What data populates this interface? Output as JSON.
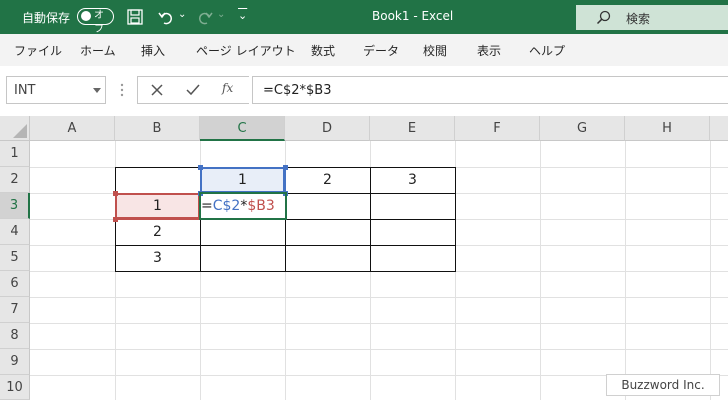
{
  "titlebar": {
    "autosave_label": "自動保存",
    "autosave_state": "オフ",
    "undo_caret": "⌄",
    "redo_caret": "⌄",
    "customize": "⌄",
    "doc_title": "Book1  -  Excel",
    "search_placeholder": "検索"
  },
  "ribbon": {
    "tabs": [
      "ファイル",
      "ホーム",
      "挿入",
      "ページ レイアウト",
      "数式",
      "データ",
      "校閲",
      "表示",
      "ヘルプ"
    ]
  },
  "formula_bar": {
    "name_box": "INT",
    "fx": "fx",
    "formula": "=C$2*$B3"
  },
  "sheet": {
    "columns": [
      "A",
      "B",
      "C",
      "D",
      "E",
      "F",
      "G",
      "H"
    ],
    "rows": [
      "1",
      "2",
      "3",
      "4",
      "5",
      "6",
      "7",
      "8",
      "9",
      "10"
    ],
    "cells": {
      "C2": "1",
      "D2": "2",
      "E2": "3",
      "B3": "1",
      "B4": "2",
      "B5": "3"
    },
    "edit_cell": {
      "eq": "=",
      "ref1": "C$2",
      "op": "*",
      "ref2": "$B3"
    },
    "colors": {
      "ref1": "#4472c4",
      "ref2": "#c0504d",
      "accent": "#217346"
    }
  },
  "watermark": "Buzzword Inc."
}
